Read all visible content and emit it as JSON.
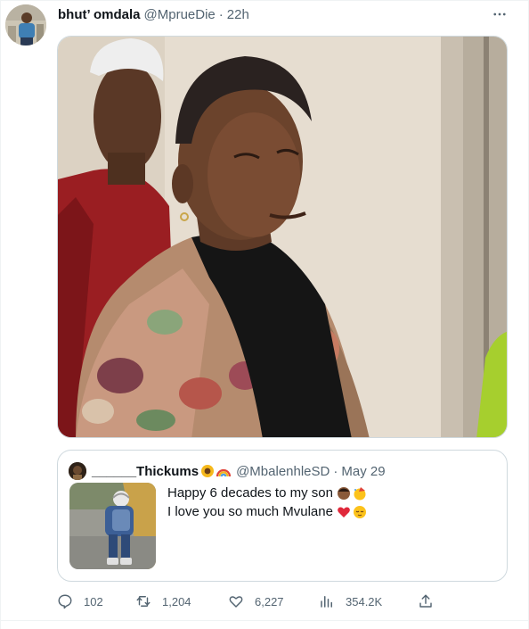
{
  "tweet": {
    "author_name": "bhut’ omdala",
    "author_handle": "@MprueDie",
    "separator": "·",
    "time": "22h",
    "more_icon": "more-horizontal-icon"
  },
  "quote": {
    "name": "______Thickums",
    "name_emojis": [
      "sunflower-emoji",
      "rainbow-emoji"
    ],
    "handle": "@MbalenhleSD",
    "separator": "·",
    "date": "May 29",
    "text_line1": "Happy 6 decades to my son",
    "text_line1_emojis": [
      "boy-emoji",
      "partying-face-emoji"
    ],
    "text_line2": "I love you so much Mvulane",
    "text_line2_emojis": [
      "red-heart-emoji",
      "relieved-face-emoji"
    ]
  },
  "actions": {
    "replies": "102",
    "retweets": "1,204",
    "likes": "6,227",
    "views": "354.2K"
  },
  "colors": {
    "text_primary": "#0f1419",
    "text_secondary": "#536471",
    "border": "#cfd9de"
  }
}
